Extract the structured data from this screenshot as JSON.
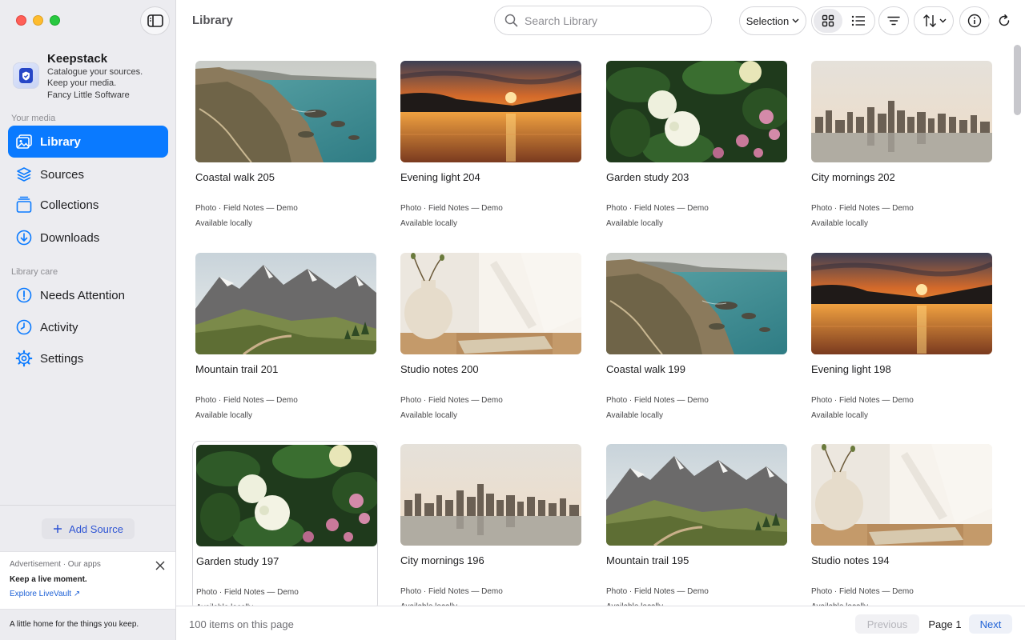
{
  "window": {
    "title": "Keepstack"
  },
  "brand": {
    "name": "Keepstack",
    "lines": [
      "Catalogue your sources.",
      "Keep your media.",
      "Fancy Little Software"
    ]
  },
  "sidebar": {
    "section_media": "Your media",
    "media_items": [
      {
        "label": "Library",
        "icon": "library-icon",
        "active": true
      },
      {
        "label": "Sources",
        "icon": "stack-icon"
      },
      {
        "label": "Collections",
        "icon": "collections-icon"
      },
      {
        "label": "Downloads",
        "icon": "download-icon"
      }
    ],
    "section_care": "Library care",
    "care_items": [
      {
        "label": "Needs Attention",
        "icon": "alert-icon"
      },
      {
        "label": "Activity",
        "icon": "clock-icon"
      },
      {
        "label": "Settings",
        "icon": "gear-icon"
      }
    ],
    "add_source_label": "Add Source",
    "ad": {
      "label": "Advertisement · Our apps",
      "title": "Keep a live moment.",
      "link": "Explore LiveVault ↗"
    },
    "tagline": "A little home for the things you keep."
  },
  "toolbar": {
    "title": "Library",
    "search_placeholder": "Search Library",
    "selection_label": "Selection",
    "view_mode": "grid"
  },
  "items": [
    {
      "title": "Coastal walk 205",
      "meta": "Photo · Field Notes — Demo",
      "status": "Available locally",
      "scene": "coast"
    },
    {
      "title": "Evening light 204",
      "meta": "Photo · Field Notes — Demo",
      "status": "Available locally",
      "scene": "sunset"
    },
    {
      "title": "Garden study 203",
      "meta": "Photo · Field Notes — Demo",
      "status": "Available locally",
      "scene": "garden"
    },
    {
      "title": "City mornings 202",
      "meta": "Photo · Field Notes — Demo",
      "status": "Available locally",
      "scene": "city"
    },
    {
      "title": "Mountain trail 201",
      "meta": "Photo · Field Notes — Demo",
      "status": "Available locally",
      "scene": "mountain"
    },
    {
      "title": "Studio notes 200",
      "meta": "Photo · Field Notes — Demo",
      "status": "Available locally",
      "scene": "studio"
    },
    {
      "title": "Coastal walk 199",
      "meta": "Photo · Field Notes — Demo",
      "status": "Available locally",
      "scene": "coast"
    },
    {
      "title": "Evening light 198",
      "meta": "Photo · Field Notes — Demo",
      "status": "Available locally",
      "scene": "sunset"
    },
    {
      "title": "Garden study 197",
      "meta": "Photo · Field Notes — Demo",
      "status": "Available locally",
      "scene": "garden"
    },
    {
      "title": "City mornings 196",
      "meta": "Photo · Field Notes — Demo",
      "status": "Available locally",
      "scene": "city"
    },
    {
      "title": "Mountain trail 195",
      "meta": "Photo · Field Notes — Demo",
      "status": "Available locally",
      "scene": "mountain"
    },
    {
      "title": "Studio notes 194",
      "meta": "Photo · Field Notes — Demo",
      "status": "Available locally",
      "scene": "studio"
    }
  ],
  "footer": {
    "count_text": "100 items on this page",
    "prev_label": "Previous",
    "page_label": "Page 1",
    "next_label": "Next"
  },
  "colors": {
    "accent": "#0a7aff",
    "sidebar_bg": "#ececf0",
    "link": "#1f62d6"
  }
}
